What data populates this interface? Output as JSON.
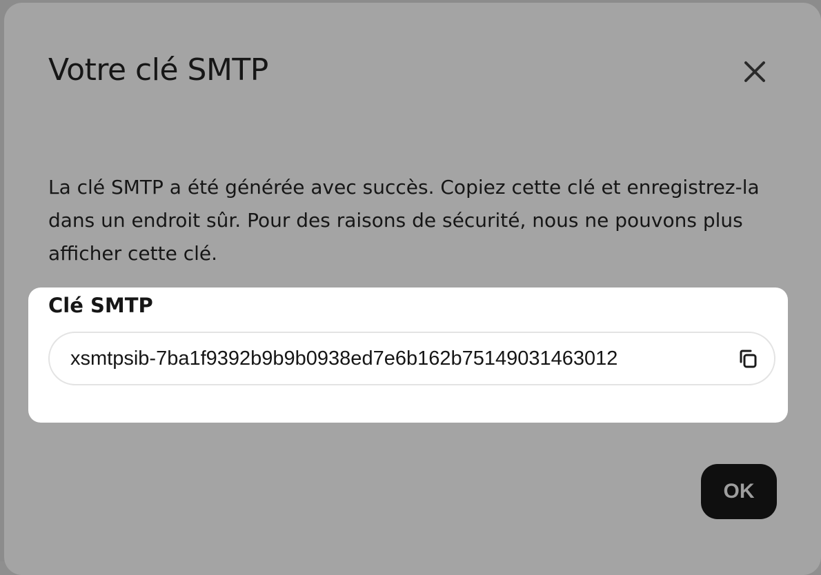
{
  "modal": {
    "title": "Votre clé SMTP",
    "description": "La clé SMTP a été générée avec succès. Copiez cette clé et enregistrez-la dans un endroit sûr. Pour des raisons de sécurité, nous ne pouvons plus afficher cette clé.",
    "key_label": "Clé SMTP",
    "key_value": "xsmtpsib-7ba1f9392b9b9b0938ed7e6b162b75149031463012",
    "ok_label": "OK",
    "close_icon": "close-icon",
    "copy_icon": "copy-icon"
  },
  "colors": {
    "modal_background": "#a4a4a4",
    "card_background": "#ffffff",
    "primary_button": "#0f0f0f",
    "text": "#161616"
  }
}
